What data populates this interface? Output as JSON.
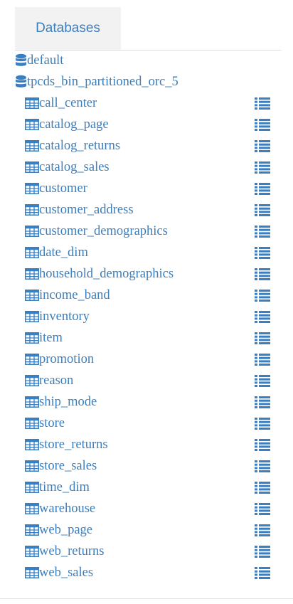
{
  "tabs": {
    "active_label": "Databases"
  },
  "colors": {
    "link": "#3a7fc0",
    "tab_bg": "#f2f2f2"
  },
  "icons": {
    "database": "database-icon",
    "table": "table-icon",
    "list": "list-icon"
  },
  "tree": {
    "databases": [
      {
        "name": "default"
      },
      {
        "name": "tpcds_bin_partitioned_orc_5",
        "tables": [
          "call_center",
          "catalog_page",
          "catalog_returns",
          "catalog_sales",
          "customer",
          "customer_address",
          "customer_demographics",
          "date_dim",
          "household_demographics",
          "income_band",
          "inventory",
          "item",
          "promotion",
          "reason",
          "ship_mode",
          "store",
          "store_returns",
          "store_sales",
          "time_dim",
          "warehouse",
          "web_page",
          "web_returns",
          "web_sales"
        ]
      }
    ]
  }
}
